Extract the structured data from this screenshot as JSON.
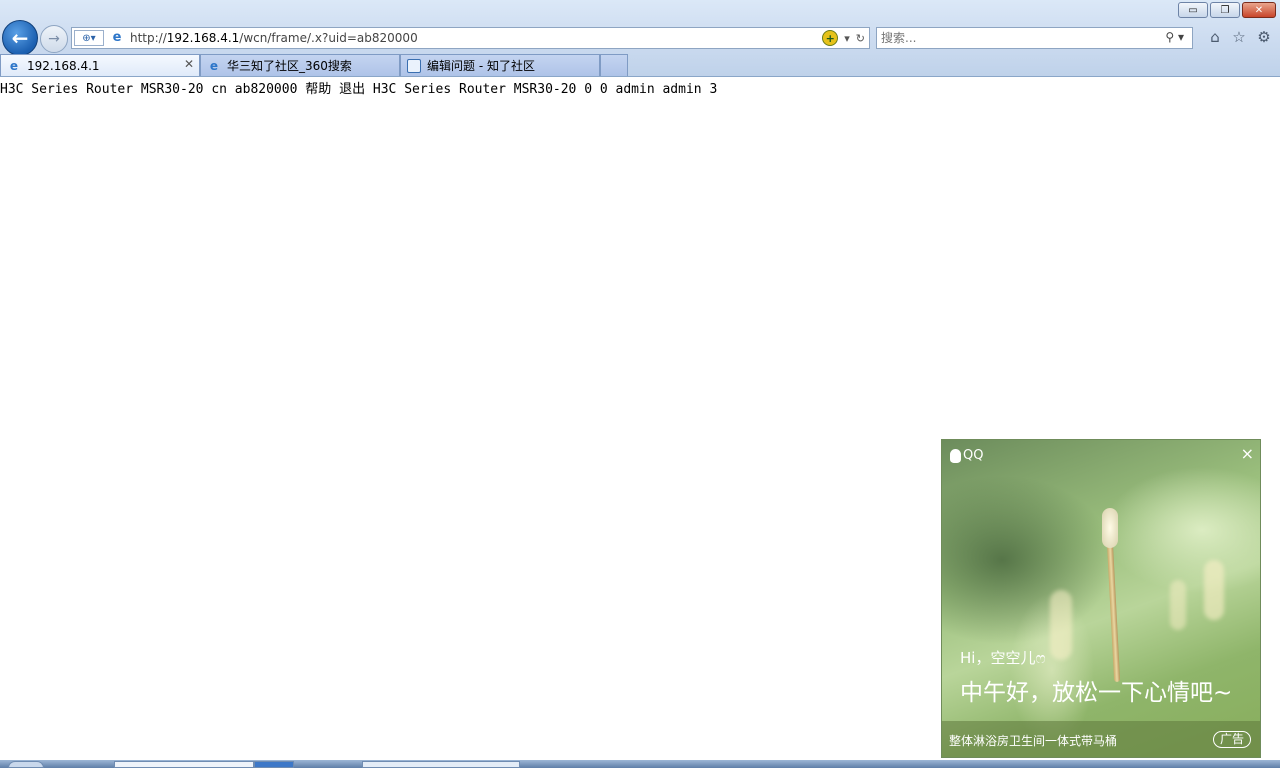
{
  "window": {
    "buttons": {
      "minimize": "▭",
      "restore": "❐",
      "close": "✕"
    }
  },
  "nav": {
    "back_icon": "arrow-left-icon",
    "forward_icon": "arrow-right-icon"
  },
  "address": {
    "url_prefix": "http://",
    "url_host": "192.168.4.1",
    "url_path": "/wcn/frame/.x?uid=ab820000",
    "compat_label": "⊕▾"
  },
  "search": {
    "placeholder": "搜索..."
  },
  "tabs": [
    {
      "label": "192.168.4.1",
      "active": true
    },
    {
      "label": "华三知了社区_360搜索",
      "active": false
    },
    {
      "label": "编辑问题 - 知了社区",
      "active": false
    }
  ],
  "content": {
    "text": "H3C Series Router MSR30-20 cn ab820000 帮助 退出 H3C Series Router MSR30-20 0 0 admin admin 3"
  },
  "qq_popup": {
    "brand": "QQ",
    "close": "×",
    "greeting_name": "Hi，空空儿ෆ",
    "greeting": "中午好，放松一下心情吧~",
    "ad_text": "整体淋浴房卫生间一体式带马桶",
    "ad_badge": "广告"
  },
  "colors": {
    "chrome_bg": "#cddcf0",
    "back_button": "#1b5fb0",
    "close_button": "#c8452a"
  }
}
